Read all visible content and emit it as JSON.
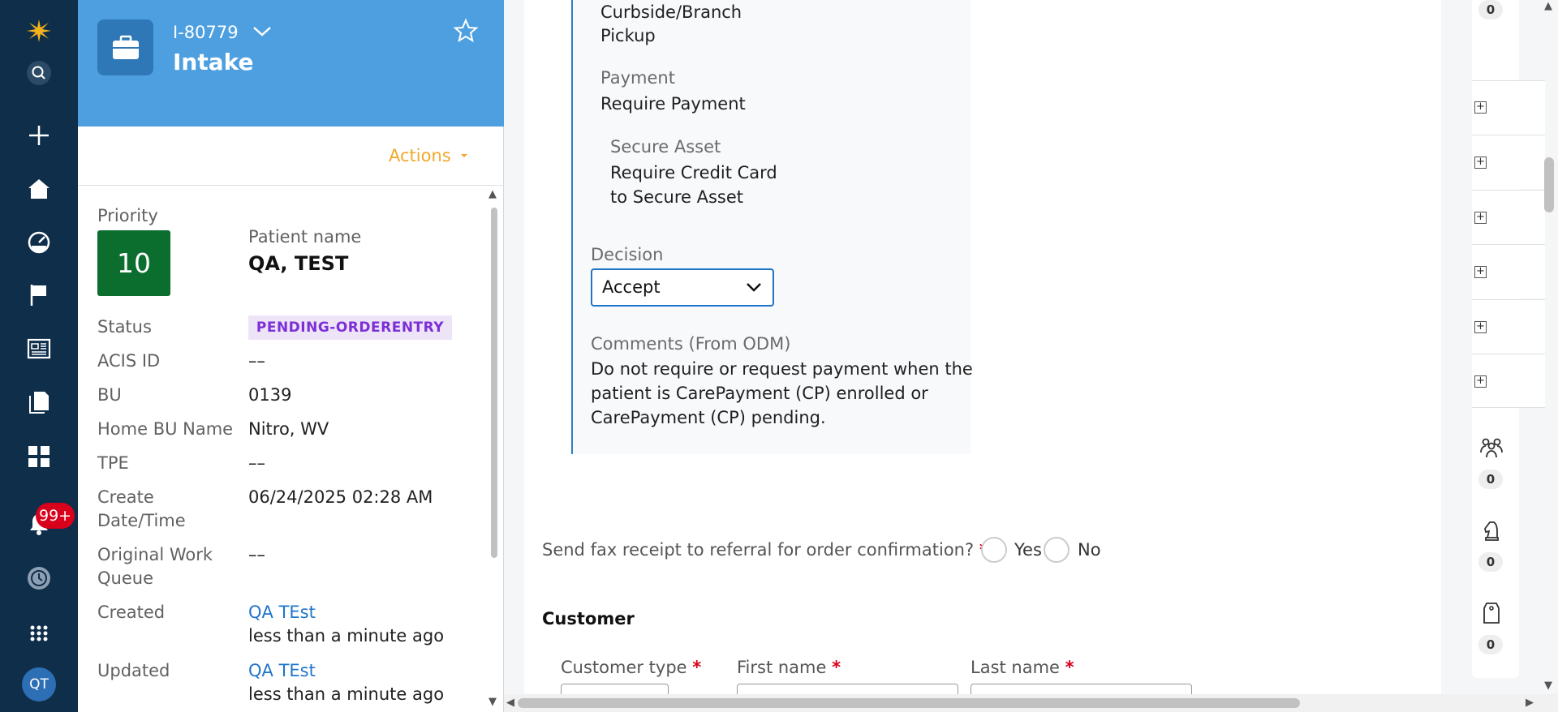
{
  "nav": {
    "notification_count": "99+",
    "avatar_initials": "QT"
  },
  "case": {
    "id": "I-80779",
    "title": "Intake",
    "actions_label": "Actions",
    "priority_label": "Priority",
    "priority_value": "10",
    "patient_name_label": "Patient name",
    "patient_name": "QA, TEST",
    "fields": [
      {
        "label": "Status",
        "value": "PENDING-ORDERENTRY"
      },
      {
        "label": "ACIS ID",
        "value": "––"
      },
      {
        "label": "BU",
        "value": "0139"
      },
      {
        "label": "Home BU Name",
        "value": "Nitro, WV"
      },
      {
        "label": "TPE",
        "value": "––"
      },
      {
        "label": "Create",
        "label2": "Date/Time",
        "value": "06/24/2025 02:28 AM"
      },
      {
        "label": "Original Work",
        "label2": "Queue",
        "value": "––"
      }
    ],
    "created_label": "Created",
    "created_by": "QA TEst",
    "created_when": "less than a minute ago",
    "updated_label": "Updated",
    "updated_by": "QA TEst",
    "updated_when": "less than a minute ago"
  },
  "main": {
    "pickup_line1": "Curbside/Branch",
    "pickup_line2": "Pickup",
    "payment_label": "Payment",
    "payment_value": "Require Payment",
    "secure_label": "Secure Asset",
    "secure_line1": "Require Credit Card",
    "secure_line2": "to Secure Asset",
    "decision_label": "Decision",
    "decision_value": "Accept",
    "comments_label": "Comments (From ODM)",
    "comments_lines": [
      "Do not require or request payment when the",
      "patient is CarePayment (CP) enrolled or",
      "CarePayment (CP) pending."
    ],
    "fax_question": "Send fax receipt to referral for order confirmation?",
    "required_mark": "*",
    "yes_label": "Yes",
    "no_label": "No",
    "customer_heading": "Customer",
    "customer_type_label": "Customer type",
    "first_name_label": "First name",
    "last_name_label": "Last name"
  },
  "rail": {
    "counts": [
      "0",
      "0",
      "0",
      "0"
    ],
    "icons": [
      "people-icon",
      "chess-knight-icon",
      "tag-icon"
    ]
  },
  "colors": {
    "nav_bg": "#0f2e4a",
    "header_blue": "#4d9fe0",
    "priority_green": "#0b6e2e",
    "actions_orange": "#f0a828",
    "link_blue": "#1f75c8",
    "status_purple": "#7c2fd6"
  }
}
